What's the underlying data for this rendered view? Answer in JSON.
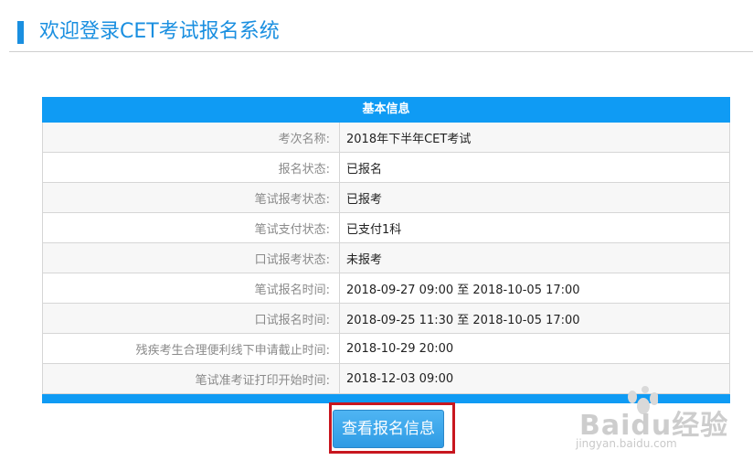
{
  "header": {
    "title": "欢迎登录CET考试报名系统"
  },
  "info": {
    "caption": "基本信息",
    "rows": [
      {
        "label": "考次名称:",
        "value": "2018年下半年CET考试"
      },
      {
        "label": "报名状态:",
        "value": "已报名"
      },
      {
        "label": "笔试报考状态:",
        "value": "已报考"
      },
      {
        "label": "笔试支付状态:",
        "value": "已支付1科"
      },
      {
        "label": "口试报考状态:",
        "value": "未报考"
      },
      {
        "label": "笔试报名时间:",
        "value": "2018-09-27 09:00 至 2018-10-05 17:00"
      },
      {
        "label": "口试报名时间:",
        "value": "2018-09-25 11:30 至 2018-10-05 17:00"
      },
      {
        "label": "残疾考生合理便利线下申请截止时间:",
        "value": "2018-10-29 20:00"
      },
      {
        "label": "笔试准考证打印开始时间:",
        "value": "2018-12-03 09:00"
      }
    ]
  },
  "button": {
    "label": "查看报名信息"
  },
  "watermark": {
    "brand": "Baidu经验",
    "url": "jingyan.baidu.com"
  },
  "colors": {
    "accent": "#1a8fe0",
    "table_header": "#0f9bf4",
    "highlight_border": "#c8171f"
  }
}
